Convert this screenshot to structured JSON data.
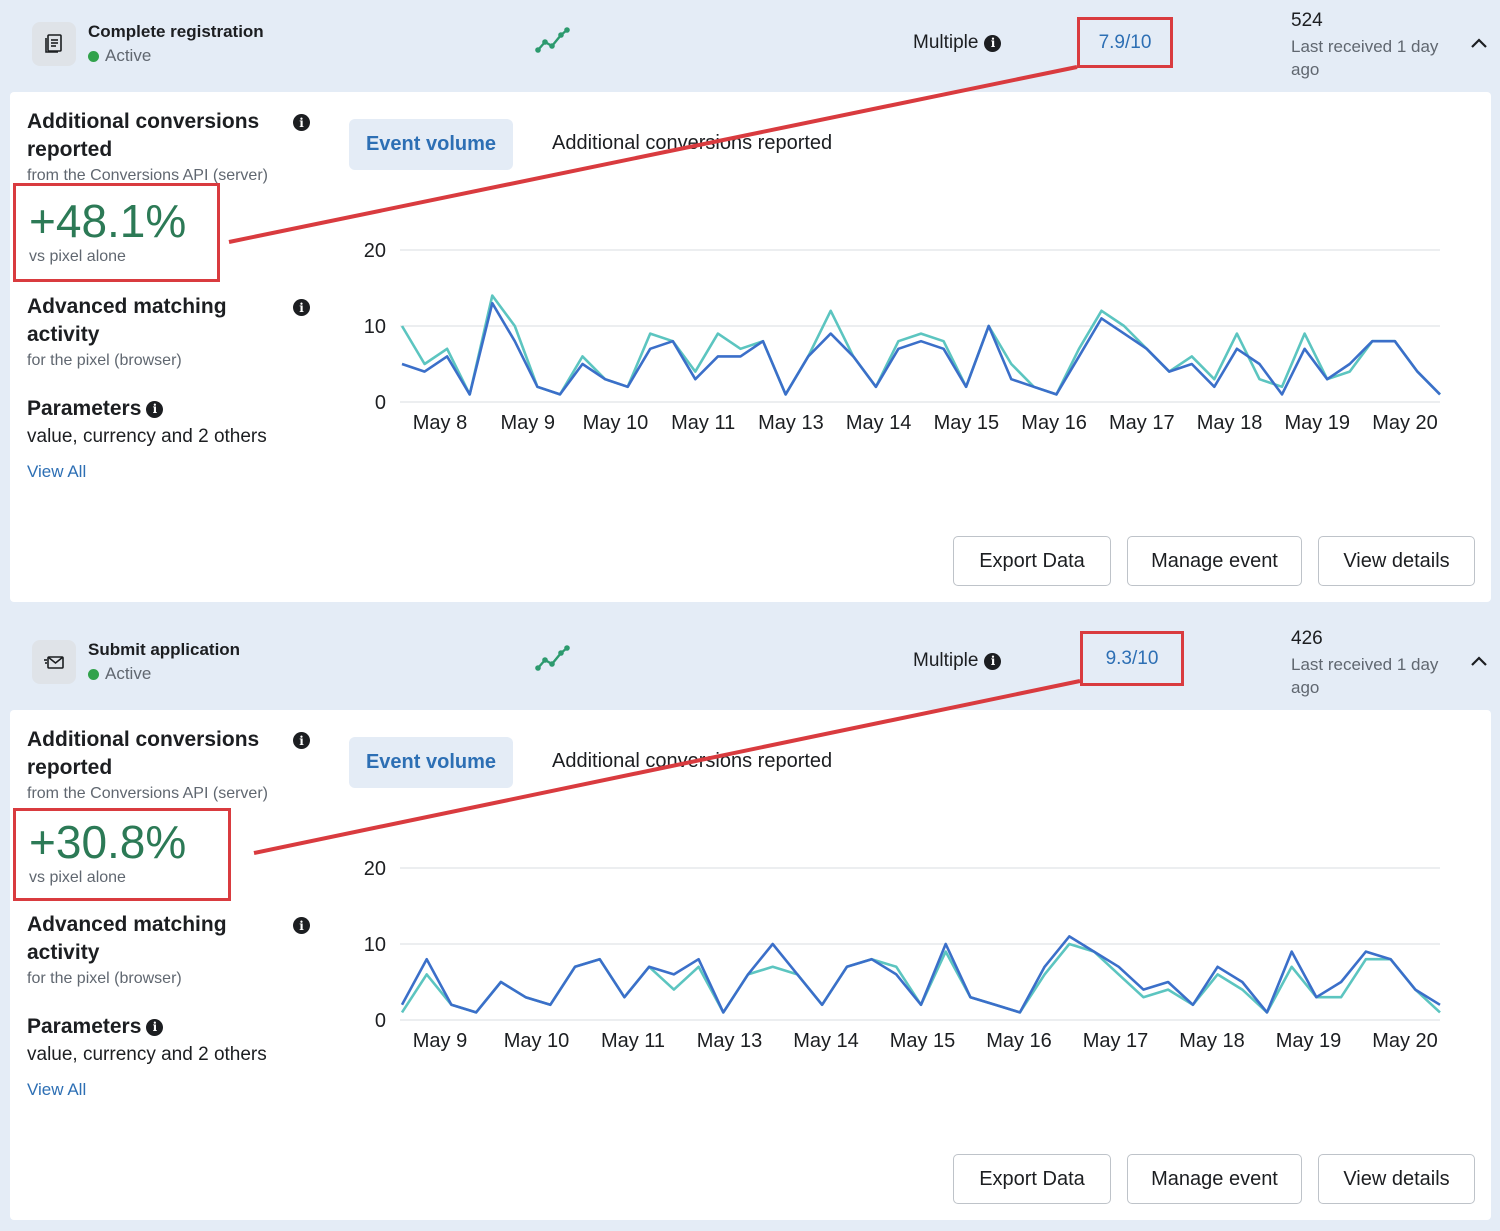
{
  "colors": {
    "accent": "#2d6fb4",
    "positive": "#2c7a56",
    "highlight": "#d93b3f",
    "series_dark": "#3b6fc9",
    "series_light": "#5cc5c0",
    "status_active": "#31a24c"
  },
  "sections": [
    {
      "event_icon": "document-stack-icon",
      "event_name": "Complete registration",
      "status": "Active",
      "trend_icon": "trend-line-icon",
      "source": "Multiple",
      "score": "7.9/10",
      "count": "524",
      "last_received": "Last received 1 day ago",
      "additional": {
        "title": "Additional conversions reported",
        "subtitle": "from the Conversions API (server)",
        "percent": "+48.1%",
        "percent_sub": "vs pixel alone"
      },
      "advanced": {
        "title": "Advanced matching activity",
        "subtitle": "for the pixel (browser)"
      },
      "parameters": {
        "title": "Parameters",
        "value": "value, currency and 2 others",
        "link": "View All"
      },
      "tabs": [
        "Event volume",
        "Additional conversions reported"
      ],
      "buttons": [
        "Export Data",
        "Manage event",
        "View details"
      ]
    },
    {
      "event_icon": "envelope-icon",
      "event_name": "Submit application",
      "status": "Active",
      "trend_icon": "trend-line-icon",
      "source": "Multiple",
      "score": "9.3/10",
      "count": "426",
      "last_received": "Last received 1 day ago",
      "additional": {
        "title": "Additional conversions reported",
        "subtitle": "from the Conversions API (server)",
        "percent": "+30.8%",
        "percent_sub": "vs pixel alone"
      },
      "advanced": {
        "title": "Advanced matching activity",
        "subtitle": "for the pixel (browser)"
      },
      "parameters": {
        "title": "Parameters",
        "value": "value, currency and 2 others",
        "link": "View All"
      },
      "tabs": [
        "Event volume",
        "Additional conversions reported"
      ],
      "buttons": [
        "Export Data",
        "Manage event",
        "View details"
      ]
    }
  ],
  "chart_data": [
    {
      "type": "line",
      "ylim": [
        0,
        20
      ],
      "yticks": [
        0,
        10,
        20
      ],
      "grid": true,
      "x_tick_labels": [
        "May 8",
        "May 9",
        "May 10",
        "May 11",
        "May 13",
        "May 14",
        "May 15",
        "May 16",
        "May 17",
        "May 18",
        "May 19",
        "May 20"
      ],
      "series": [
        {
          "color": "#5cc5c0",
          "values": [
            10,
            5,
            7,
            1,
            14,
            10,
            2,
            1,
            6,
            3,
            2,
            9,
            8,
            4,
            9,
            7,
            8,
            1,
            6,
            12,
            6,
            2,
            8,
            9,
            8,
            2,
            10,
            5,
            2,
            1,
            7,
            12,
            10,
            7,
            4,
            6,
            3,
            9,
            3,
            2,
            9,
            3,
            4,
            8,
            8,
            4,
            1
          ]
        },
        {
          "color": "#3b6fc9",
          "values": [
            5,
            4,
            6,
            1,
            13,
            8,
            2,
            1,
            5,
            3,
            2,
            7,
            8,
            3,
            6,
            6,
            8,
            1,
            6,
            9,
            6,
            2,
            7,
            8,
            7,
            2,
            10,
            3,
            2,
            1,
            6,
            11,
            9,
            7,
            4,
            5,
            2,
            7,
            5,
            1,
            7,
            3,
            5,
            8,
            8,
            4,
            1
          ]
        }
      ]
    },
    {
      "type": "line",
      "ylim": [
        0,
        20
      ],
      "yticks": [
        0,
        10,
        20
      ],
      "grid": true,
      "x_tick_labels": [
        "May 9",
        "May 10",
        "May 11",
        "May 13",
        "May 14",
        "May 15",
        "May 16",
        "May 17",
        "May 18",
        "May 19",
        "May 20"
      ],
      "series": [
        {
          "color": "#5cc5c0",
          "values": [
            1,
            6,
            2,
            1,
            5,
            3,
            2,
            7,
            8,
            3,
            7,
            4,
            7,
            1,
            6,
            7,
            6,
            2,
            7,
            8,
            7,
            2,
            9,
            3,
            2,
            1,
            6,
            10,
            9,
            6,
            3,
            4,
            2,
            6,
            4,
            1,
            7,
            3,
            3,
            8,
            8,
            4,
            1
          ]
        },
        {
          "color": "#3b6fc9",
          "values": [
            2,
            8,
            2,
            1,
            5,
            3,
            2,
            7,
            8,
            3,
            7,
            6,
            8,
            1,
            6,
            10,
            6,
            2,
            7,
            8,
            6,
            2,
            10,
            3,
            2,
            1,
            7,
            11,
            9,
            7,
            4,
            5,
            2,
            7,
            5,
            1,
            9,
            3,
            5,
            9,
            8,
            4,
            2
          ]
        }
      ]
    }
  ]
}
